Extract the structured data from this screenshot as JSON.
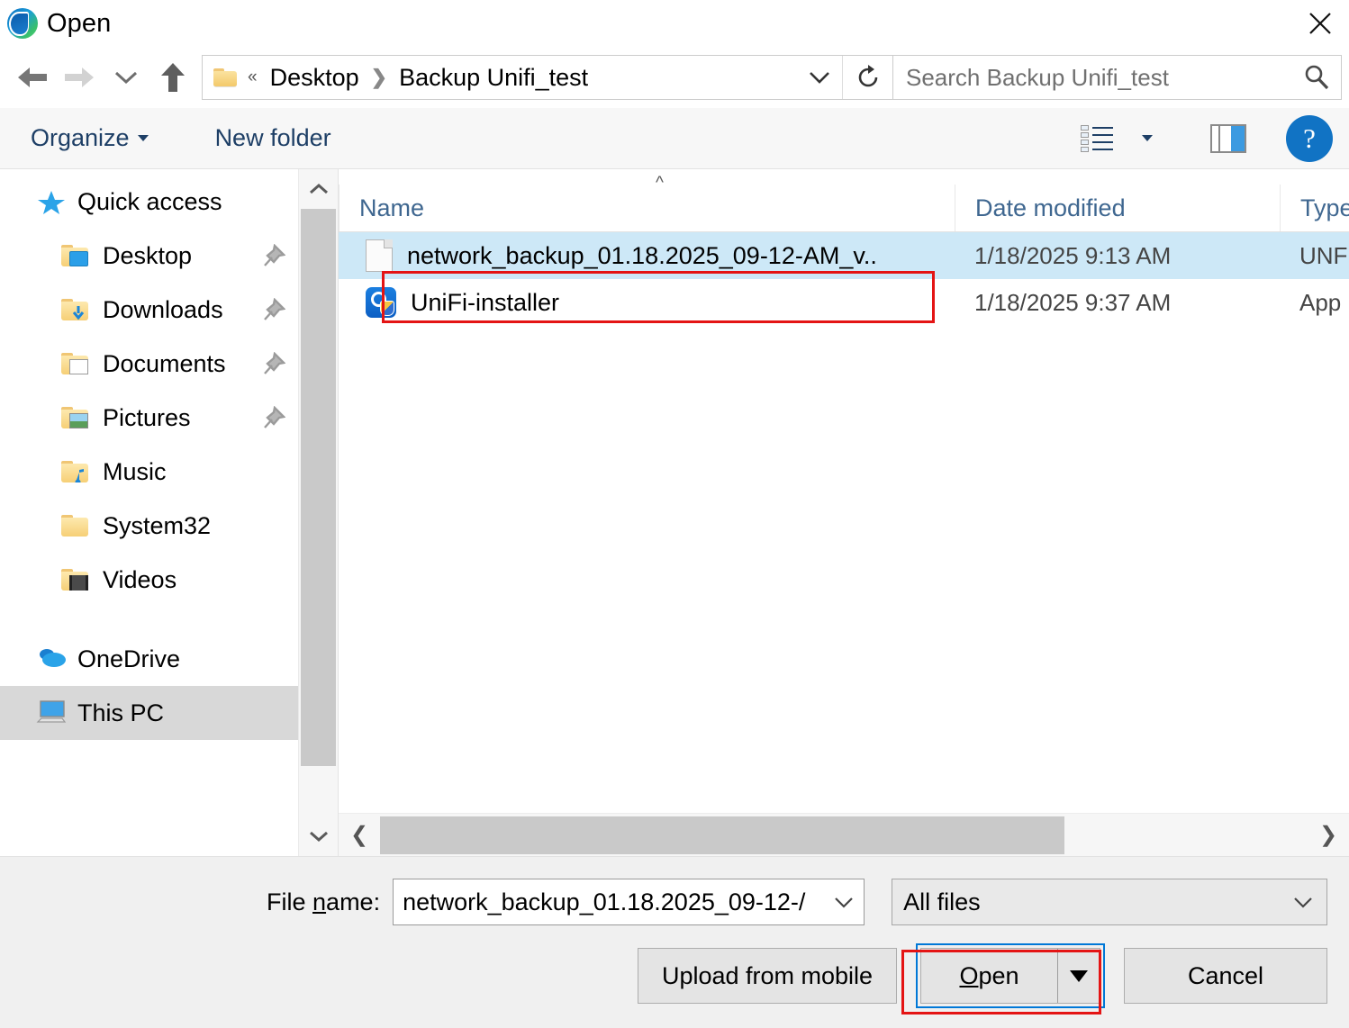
{
  "window": {
    "title": "Open",
    "app_icon": "edge-logo",
    "close_label": "✕"
  },
  "nav": {
    "back": "back-arrow",
    "forward": "forward-arrow",
    "recent": "recent-locations-chevron",
    "up": "up-arrow",
    "refresh": "refresh-icon"
  },
  "address": {
    "folder_icon": "folder-icon",
    "overflow": "«",
    "crumbs": [
      "Desktop",
      "Backup Unifi_test"
    ],
    "separator": "❯",
    "dropdown": "chevron-down-icon"
  },
  "search": {
    "placeholder": "Search Backup Unifi_test",
    "value": "",
    "icon": "search-icon"
  },
  "toolbar": {
    "organize": "Organize",
    "new_folder": "New folder",
    "view_icon": "view-options-icon",
    "view_caret": "chevron-down-icon",
    "preview_pane": "preview-pane-icon",
    "help": "?"
  },
  "sidebar": {
    "items": [
      {
        "label": "Quick access",
        "icon": "star-icon",
        "level": 0,
        "pinned": false,
        "selected": false
      },
      {
        "label": "Desktop",
        "icon": "folder-desktop",
        "level": 1,
        "pinned": true,
        "selected": false
      },
      {
        "label": "Downloads",
        "icon": "folder-downloads",
        "level": 1,
        "pinned": true,
        "selected": false
      },
      {
        "label": "Documents",
        "icon": "folder-documents",
        "level": 1,
        "pinned": true,
        "selected": false
      },
      {
        "label": "Pictures",
        "icon": "folder-pictures",
        "level": 1,
        "pinned": true,
        "selected": false
      },
      {
        "label": "Music",
        "icon": "folder-music",
        "level": 1,
        "pinned": false,
        "selected": false
      },
      {
        "label": "System32",
        "icon": "folder-plain",
        "level": 1,
        "pinned": false,
        "selected": false
      },
      {
        "label": "Videos",
        "icon": "folder-videos",
        "level": 1,
        "pinned": false,
        "selected": false
      },
      {
        "label": "OneDrive",
        "icon": "onedrive-cloud",
        "level": 0,
        "pinned": false,
        "selected": false
      },
      {
        "label": "This PC",
        "icon": "monitor-icon",
        "level": 0,
        "pinned": false,
        "selected": true
      }
    ]
  },
  "filelist": {
    "columns": [
      "Name",
      "Date modified",
      "Type"
    ],
    "sort_indicator": "^",
    "rows": [
      {
        "name": "network_backup_01.18.2025_09-12-AM_v..",
        "date": "1/18/2025 9:13 AM",
        "type": "UNF",
        "icon": "document-icon",
        "selected": true
      },
      {
        "name": "UniFi-installer",
        "date": "1/18/2025 9:37 AM",
        "type": "App",
        "icon": "unifi-installer-icon",
        "selected": false
      }
    ]
  },
  "footer": {
    "filename_label_pre": "File ",
    "filename_label_key": "n",
    "filename_label_post": "ame:",
    "filename_value": "network_backup_01.18.2025_09-12-/",
    "filename_chevron": "chevron-down-icon",
    "filter_value": "All files",
    "filter_chevron": "chevron-down-icon",
    "upload_button": "Upload from mobile",
    "open_button_pre": "",
    "open_button_key": "O",
    "open_button_post": "pen",
    "open_split_arrow": "▼",
    "cancel_button": "Cancel"
  },
  "colors": {
    "accent": "#0078d7",
    "annotation": "#e41414",
    "selection": "#cde8f7",
    "toolbar_text": "#1e3f66",
    "header_text": "#3f6790"
  }
}
